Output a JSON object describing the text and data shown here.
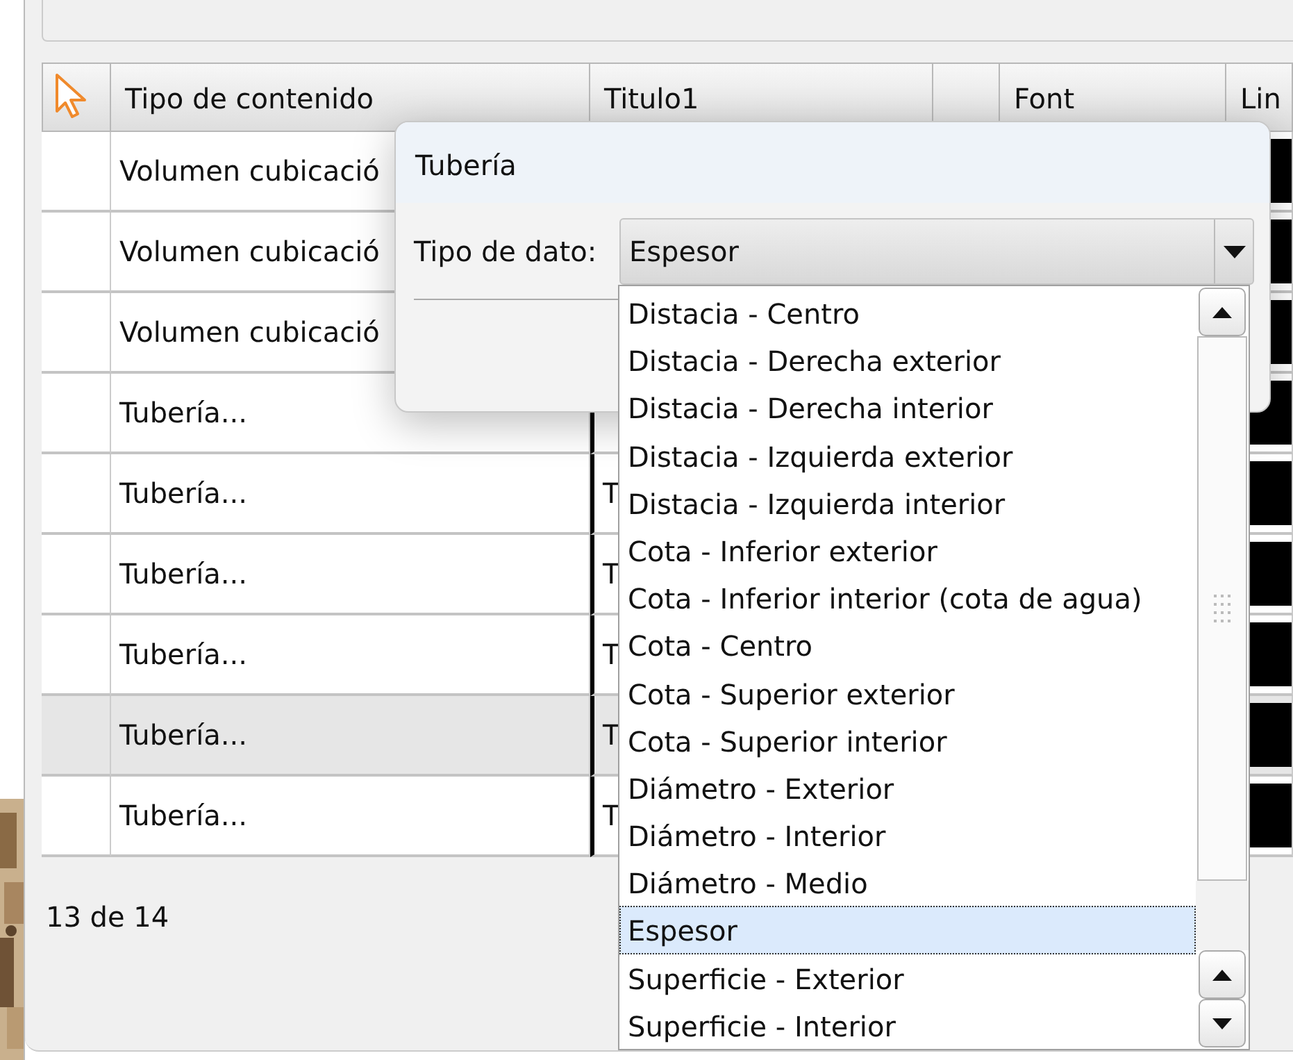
{
  "table": {
    "columns": [
      {
        "kind": "cursor"
      },
      {
        "kind": "text",
        "label": "Tipo de contenido"
      },
      {
        "kind": "text",
        "label": "Titulo1"
      },
      {
        "kind": "blank"
      },
      {
        "kind": "text",
        "label": "Font"
      },
      {
        "kind": "text",
        "label": "Lin"
      }
    ],
    "rows": [
      {
        "content": "Volumen cubicació",
        "title": "",
        "color": "#000000",
        "selected": false
      },
      {
        "content": "Volumen cubicació",
        "title": "",
        "color": "#000000",
        "selected": false
      },
      {
        "content": "Volumen cubicació",
        "title": "",
        "color": "#000000",
        "selected": false
      },
      {
        "content": "Tubería...",
        "title": "",
        "color": "#000000",
        "selected": false
      },
      {
        "content": "Tubería...",
        "title": "T",
        "color": "#000000",
        "selected": false
      },
      {
        "content": "Tubería...",
        "title": "T",
        "color": "#000000",
        "selected": false
      },
      {
        "content": "Tubería...",
        "title": "T",
        "color": "#000000",
        "selected": false
      },
      {
        "content": "Tubería...",
        "title": "T",
        "color": "#000000",
        "selected": true
      },
      {
        "content": "Tubería...",
        "title": "T",
        "color": "#000000",
        "selected": false
      }
    ]
  },
  "record_count": "13 de 14",
  "dialog": {
    "title": "Tubería",
    "field_label": "Tipo de dato:",
    "value": "Espesor",
    "options": [
      {
        "label": "Distacia - Centro",
        "selected": false
      },
      {
        "label": "Distacia - Derecha exterior",
        "selected": false
      },
      {
        "label": "Distacia - Derecha interior",
        "selected": false
      },
      {
        "label": "Distacia - Izquierda exterior",
        "selected": false
      },
      {
        "label": "Distacia - Izquierda interior",
        "selected": false
      },
      {
        "label": "Cota - Inferior exterior",
        "selected": false
      },
      {
        "label": "Cota - Inferior interior (cota de agua)",
        "selected": false
      },
      {
        "label": "Cota - Centro",
        "selected": false
      },
      {
        "label": "Cota - Superior exterior",
        "selected": false
      },
      {
        "label": "Cota - Superior interior",
        "selected": false
      },
      {
        "label": "Diámetro - Exterior",
        "selected": false
      },
      {
        "label": "Diámetro - Interior",
        "selected": false
      },
      {
        "label": "Diámetro - Medio",
        "selected": false
      },
      {
        "label": "Espesor",
        "selected": true
      },
      {
        "label": "Superficie - Exterior",
        "selected": false
      },
      {
        "label": "Superficie - Interior",
        "selected": false
      }
    ]
  }
}
